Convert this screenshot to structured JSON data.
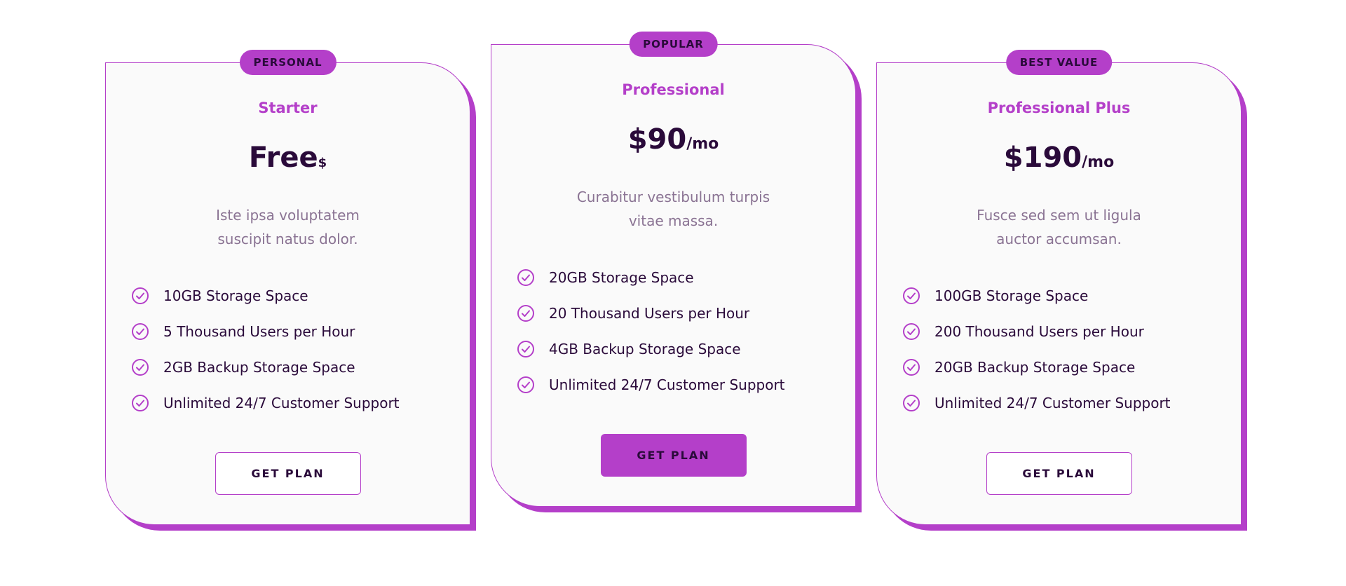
{
  "colors": {
    "accent": "#b43fc9",
    "text_dark": "#2a0a3a",
    "text_muted": "#8a7393",
    "card_bg": "#fafafa"
  },
  "icons": {
    "feature": "check-circle-icon"
  },
  "plans": [
    {
      "badge": "PERSONAL",
      "name": "Starter",
      "price": "Free",
      "price_unit": "$",
      "description": "Iste ipsa voluptatem suscipit natus dolor.",
      "features": [
        "10GB Storage Space",
        "5 Thousand Users per Hour",
        "2GB Backup Storage Space",
        "Unlimited 24/7 Customer Support"
      ],
      "button": "GET PLAN",
      "highlighted": false
    },
    {
      "badge": "POPULAR",
      "name": "Professional",
      "price": "$90",
      "price_unit": "/mo",
      "description": "Curabitur vestibulum turpis vitae massa.",
      "features": [
        "20GB Storage Space",
        "20 Thousand Users per Hour",
        "4GB Backup Storage Space",
        "Unlimited 24/7 Customer Support"
      ],
      "button": "GET PLAN",
      "highlighted": true
    },
    {
      "badge": "BEST VALUE",
      "name": "Professional Plus",
      "price": "$190",
      "price_unit": "/mo",
      "description": "Fusce sed sem ut ligula auctor accumsan.",
      "features": [
        "100GB Storage Space",
        "200 Thousand Users per Hour",
        "20GB Backup Storage Space",
        "Unlimited 24/7 Customer Support"
      ],
      "button": "GET PLAN",
      "highlighted": false
    }
  ]
}
